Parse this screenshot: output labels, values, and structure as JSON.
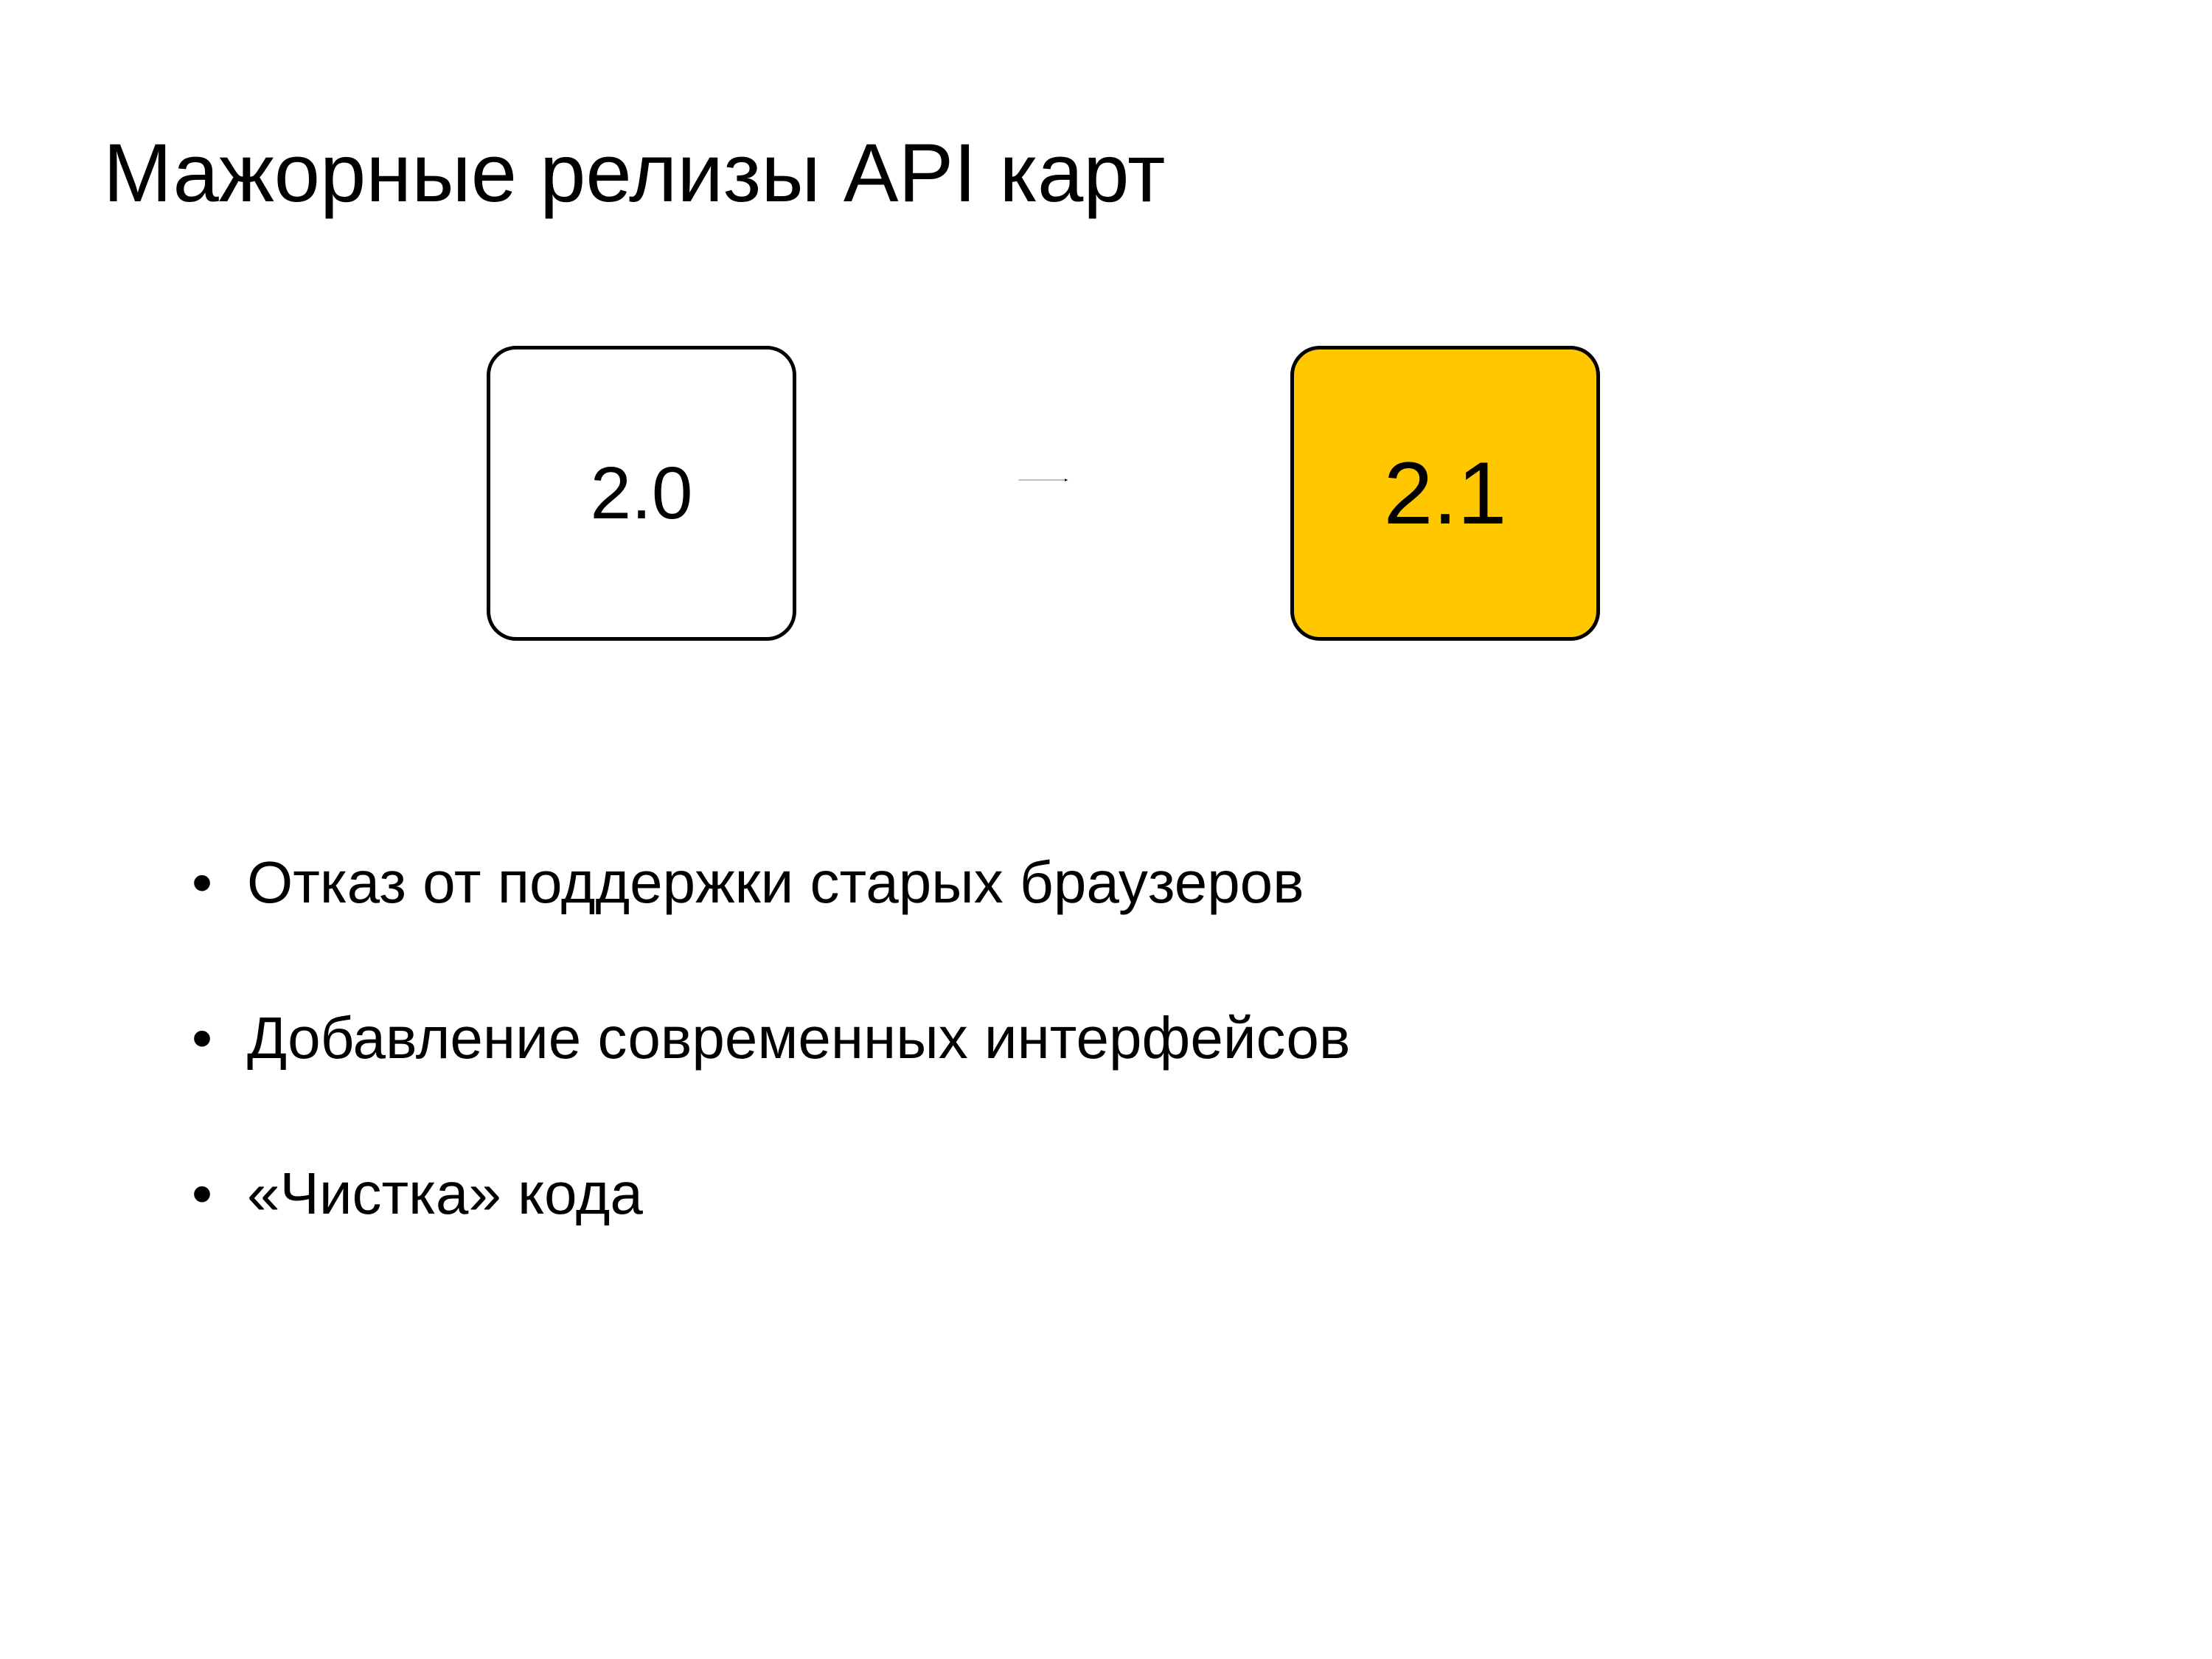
{
  "title": "Мажорные релизы API карт",
  "diagram": {
    "left_label": "2.0",
    "right_label": "2.1",
    "colors": {
      "left_bg": "#ffffff",
      "right_bg": "#ffc700",
      "border": "#000000"
    }
  },
  "bullets": [
    "Отказ от поддержки старых браузеров",
    "Добавление современных интерфейсов",
    "«Чистка» кода"
  ]
}
